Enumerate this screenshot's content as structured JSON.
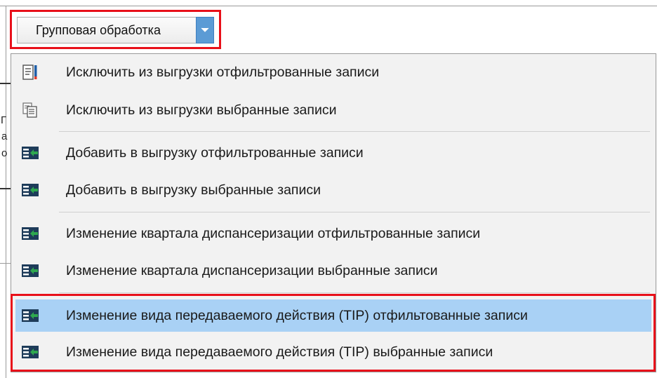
{
  "toolbar": {
    "group_button_label": "Групповая обработка"
  },
  "background": {
    "partial_chars": [
      "Г",
      "а",
      "о"
    ]
  },
  "menu": {
    "items": [
      {
        "label": "Исключить из выгрузки отфильтрованные записи",
        "icon": "filter-list-icon"
      },
      {
        "label": "Исключить из выгрузки выбранные записи",
        "icon": "document-copy-icon"
      },
      {
        "label": "Добавить в выгрузку отфильтрованные записи",
        "icon": "add-to-list-icon"
      },
      {
        "label": "Добавить в выгрузку выбранные записи",
        "icon": "add-to-list-icon"
      },
      {
        "label": "Изменение квартала диспансеризации отфильтрованные записи",
        "icon": "add-to-list-icon"
      },
      {
        "label": "Изменение квартала диспансеризации выбранные записи",
        "icon": "add-to-list-icon"
      },
      {
        "label": "Изменение вида передаваемого действия (TIP) отфильтованные записи",
        "icon": "add-to-list-icon"
      },
      {
        "label": "Изменение вида передаваемого действия (TIP) выбранные записи",
        "icon": "add-to-list-icon"
      }
    ]
  },
  "colors": {
    "highlight_border": "#e8101a",
    "hover_row": "#a9d1f5",
    "icon_dark": "#1e3c5a",
    "icon_green": "#2fa84f",
    "dropdown_arrow": "#5b9bd5"
  }
}
